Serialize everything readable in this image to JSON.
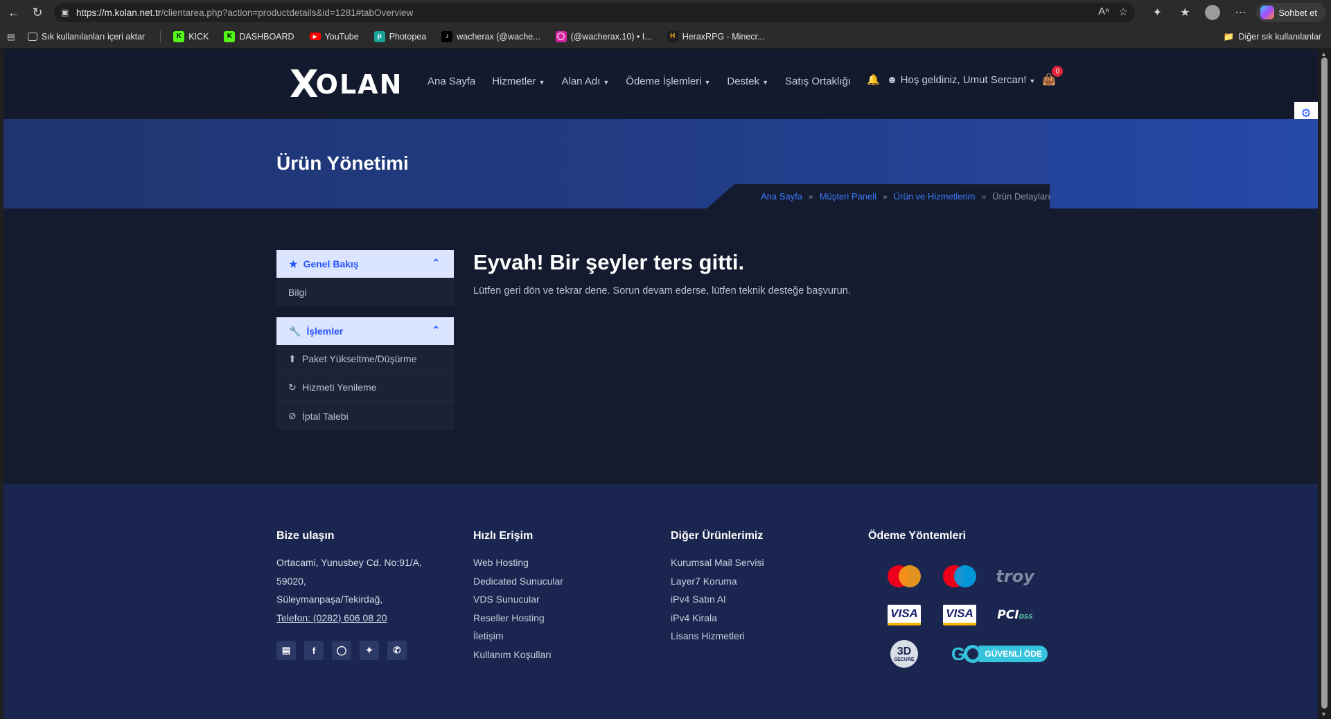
{
  "browser": {
    "url_main": "https://m.kolan.net.tr",
    "url_path": "/clientarea.php?action=productdetails&id=1281#tabOverview",
    "chat_label": "Sohbet et",
    "bookmarks": [
      {
        "label": "Sık kullanılanları içeri aktar",
        "icon": "import-icon"
      },
      {
        "label": "KICK",
        "icon": "kick-icon",
        "color": "#53fc18"
      },
      {
        "label": "DASHBOARD",
        "icon": "kick-icon",
        "color": "#53fc18"
      },
      {
        "label": "YouTube",
        "icon": "youtube-icon",
        "color": "#ff0000"
      },
      {
        "label": "Photopea",
        "icon": "photopea-icon",
        "color": "#18a497"
      },
      {
        "label": "wacherax (@wache...",
        "icon": "tiktok-icon",
        "color": "#000000"
      },
      {
        "label": "(@wacherax.10) • I...",
        "icon": "instagram-icon",
        "color": "#d6249f"
      },
      {
        "label": "HeraxRPG - Minecr...",
        "icon": "herax-icon",
        "color": "#f5a623"
      }
    ],
    "other_bookmarks": "Diğer sık kullanılanlar"
  },
  "site": {
    "logo": {
      "mark": "X",
      "text": "OLAN"
    },
    "nav": [
      {
        "label": "Ana Sayfa",
        "dropdown": false
      },
      {
        "label": "Hizmetler",
        "dropdown": true
      },
      {
        "label": "Alan Adı",
        "dropdown": true
      },
      {
        "label": "Ödeme İşlemleri",
        "dropdown": true
      },
      {
        "label": "Destek",
        "dropdown": true
      },
      {
        "label": "Satış Ortaklığı",
        "dropdown": false
      }
    ],
    "greeting": "Hoş geldiniz, Umut Sercan!",
    "cart_count": "0"
  },
  "hero": {
    "title": "Ürün Yönetimi",
    "breadcrumb": [
      "Ana Sayfa",
      "Müşteri Paneli",
      "Ürün ve Hizmetlerim"
    ],
    "breadcrumb_current": "Ürün Detayları"
  },
  "sidebar": {
    "overview": {
      "title": "Genel Bakış",
      "items": [
        "Bilgi"
      ]
    },
    "actions": {
      "title": "İşlemler",
      "items": [
        {
          "label": "Paket Yükseltme/Düşürme",
          "icon": "upgrade-arrow-icon"
        },
        {
          "label": "Hizmeti Yenileme",
          "icon": "refresh-icon"
        },
        {
          "label": "İptal Talebi",
          "icon": "ban-icon"
        }
      ]
    }
  },
  "content": {
    "title": "Eyvah! Bir şeyler ters gitti.",
    "message": "Lütfen geri dön ve tekrar dene. Sorun devam ederse, lütfen teknik desteğe başvurun."
  },
  "footer": {
    "contact": {
      "title": "Bize ulaşın",
      "lines": [
        "Ortacami, Yunusbey Cd. No:91/A,",
        "59020,",
        "Süleymanpaşa/Tekirdağ,"
      ],
      "phone": "Telefon: (0282) 606 08 20"
    },
    "quick": {
      "title": "Hızlı Erişim",
      "links": [
        "Web Hosting",
        "Dedicated Sunucular",
        "VDS Sunucular",
        "Reseller Hosting",
        "İletişim",
        "Kullanım Koşulları"
      ]
    },
    "products": {
      "title": "Diğer Ürünlerimiz",
      "links": [
        "Kurumsal Mail Servisi",
        "Layer7 Koruma",
        "iPv4 Satın Al",
        "iPv4 Kirala",
        "Lisans Hizmetleri"
      ]
    },
    "payments": {
      "title": "Ödeme Yöntemleri",
      "troy": "troy",
      "visa": "VISA",
      "pci": "PCI",
      "pci_dss": "DSS",
      "secure_3d": "3D",
      "secure_label": "SECURE",
      "go_text": "GÜVENLİ ÖDE"
    }
  }
}
